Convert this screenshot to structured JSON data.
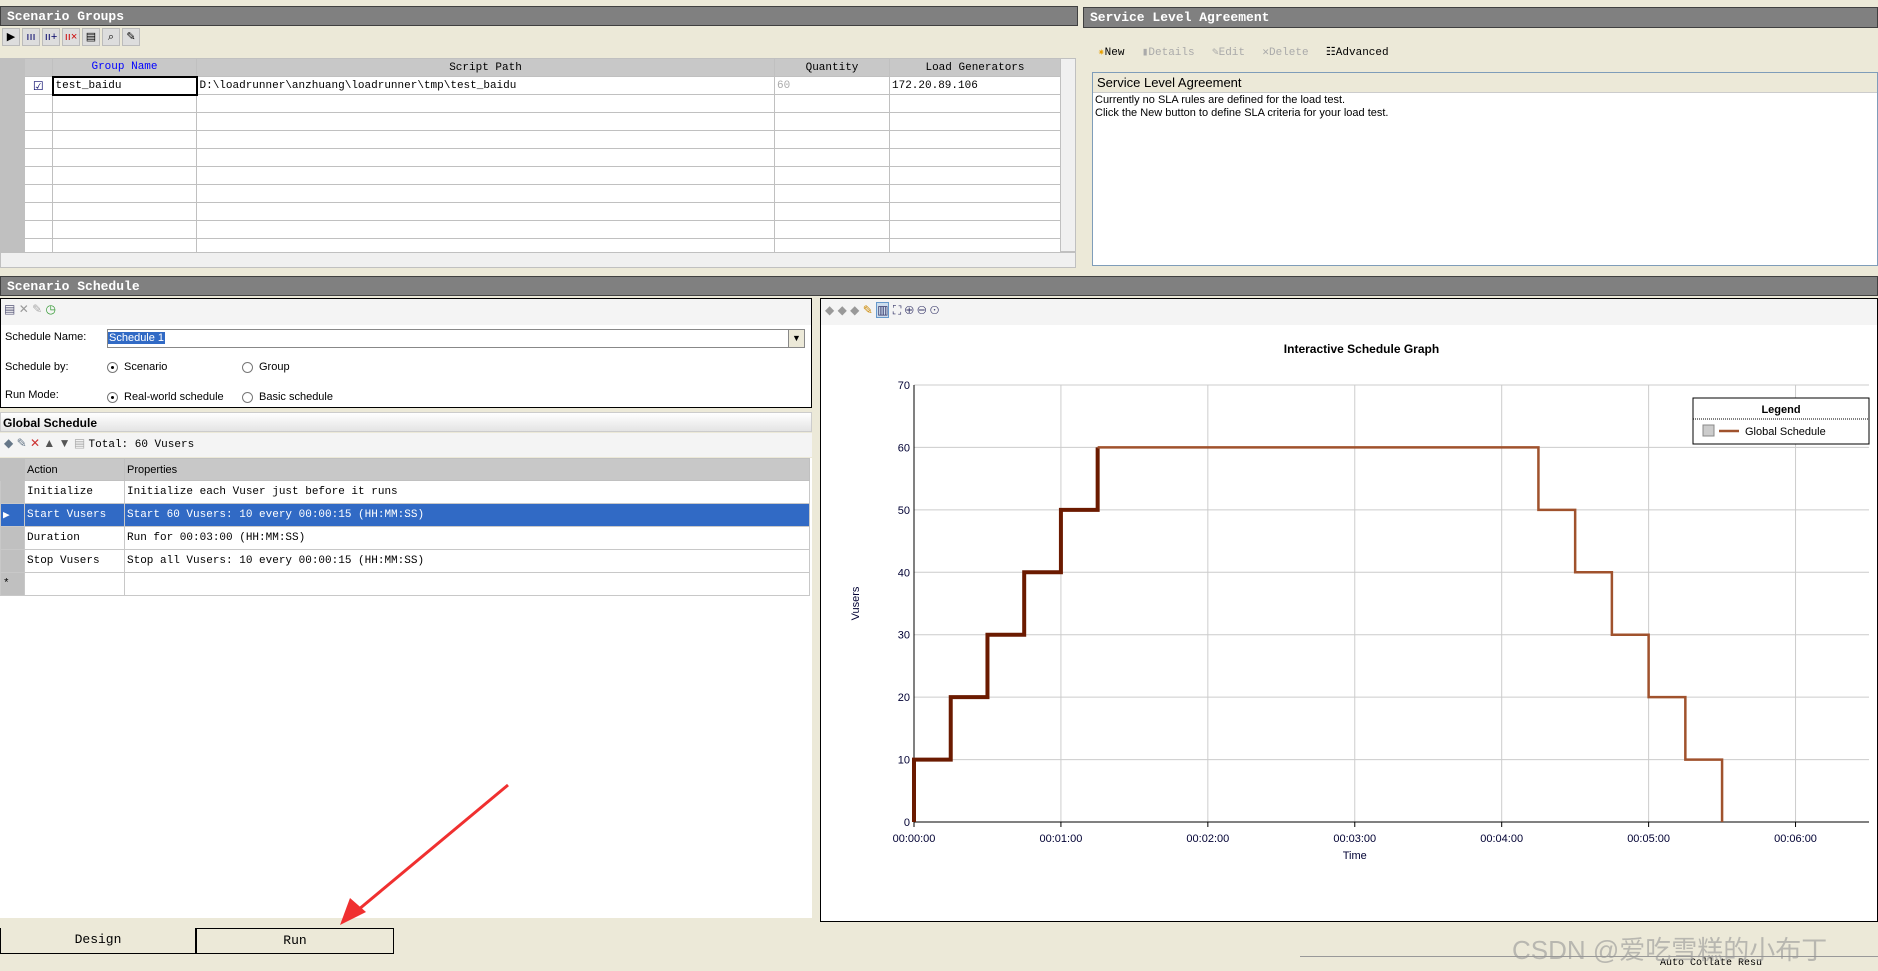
{
  "scenario_groups": {
    "title": "Scenario Groups",
    "toolbar": [
      "play-icon",
      "vusers-icon",
      "add-vusers-icon",
      "remove-vusers-icon",
      "details-icon",
      "view-script-icon",
      "edit-script-icon"
    ],
    "columns": [
      "Group Name",
      "Script Path",
      "Quantity",
      "Load Generators"
    ],
    "rows": [
      {
        "checked": true,
        "group": "test_baidu",
        "path": "D:\\loadrunner\\anzhuang\\loadrunner\\tmp\\test_baidu",
        "quantity": "60",
        "lg": "172.20.89.106"
      }
    ]
  },
  "sla": {
    "title": "Service Level Agreement",
    "toolbar": {
      "new": "New",
      "details": "Details",
      "edit": "Edit",
      "delete": "Delete",
      "advanced": "Advanced"
    },
    "box_title": "Service Level Agreement",
    "line1": "Currently no SLA rules are defined for the load test.",
    "line2": "Click the New button to define SLA criteria for your load test."
  },
  "schedule": {
    "title": "Scenario Schedule",
    "name_label": "Schedule Name:",
    "name_value": "Schedule 1",
    "by_label": "Schedule by:",
    "by_opt1": "Scenario",
    "by_opt2": "Group",
    "by_selected": "Scenario",
    "mode_label": "Run Mode:",
    "mode_opt1": "Real-world schedule",
    "mode_opt2": "Basic schedule",
    "mode_selected": "Real-world schedule",
    "global_title": "Global Schedule",
    "total": "Total: 60 Vusers",
    "columns": [
      "Action",
      "Properties"
    ],
    "rows": [
      {
        "action": "Initialize",
        "props": "Initialize each Vuser just before it runs",
        "selected": false
      },
      {
        "action": "Start  Vusers",
        "props": "Start 60 Vusers: 10 every 00:00:15 (HH:MM:SS)",
        "selected": true
      },
      {
        "action": "Duration",
        "props": "Run for 00:03:00 (HH:MM:SS)",
        "selected": false
      },
      {
        "action": "Stop Vusers",
        "props": "Stop all Vusers: 10 every 00:00:15 (HH:MM:SS)",
        "selected": false
      }
    ],
    "new_row_marker": "*"
  },
  "chart_data": {
    "type": "line",
    "title": "Interactive Schedule Graph",
    "xlabel": "Time",
    "ylabel": "Vusers",
    "xlim_seconds": [
      0,
      390
    ],
    "ylim": [
      0,
      70
    ],
    "grid": true,
    "legend": {
      "title": "Legend",
      "placement": "top-right"
    },
    "yticks": [
      "0",
      "10",
      "20",
      "30",
      "40",
      "50",
      "60",
      "70"
    ],
    "xticks": [
      "00:00:00",
      "00:01:00",
      "00:02:00",
      "00:03:00",
      "00:04:00",
      "00:05:00",
      "00:06:00"
    ],
    "series": [
      {
        "name": "Global Schedule",
        "color": "#a0522d",
        "ramp_color": "#6b1a00",
        "points": [
          [
            "00:00:00",
            0
          ],
          [
            "00:00:00",
            10
          ],
          [
            "00:00:15",
            10
          ],
          [
            "00:00:15",
            20
          ],
          [
            "00:00:30",
            20
          ],
          [
            "00:00:30",
            30
          ],
          [
            "00:00:45",
            30
          ],
          [
            "00:00:45",
            40
          ],
          [
            "00:01:00",
            40
          ],
          [
            "00:01:00",
            50
          ],
          [
            "00:01:15",
            50
          ],
          [
            "00:01:15",
            60
          ],
          [
            "00:04:15",
            60
          ],
          [
            "00:04:15",
            50
          ],
          [
            "00:04:30",
            50
          ],
          [
            "00:04:30",
            40
          ],
          [
            "00:04:45",
            40
          ],
          [
            "00:04:45",
            30
          ],
          [
            "00:05:00",
            30
          ],
          [
            "00:05:00",
            20
          ],
          [
            "00:05:15",
            20
          ],
          [
            "00:05:15",
            10
          ],
          [
            "00:05:30",
            10
          ],
          [
            "00:05:30",
            0
          ]
        ]
      }
    ]
  },
  "tabs": {
    "design": "Design",
    "run": "Run"
  },
  "status": {
    "auto_collate": "Auto Collate Resu"
  },
  "watermark": "CSDN @爱吃雪糕的小布丁"
}
